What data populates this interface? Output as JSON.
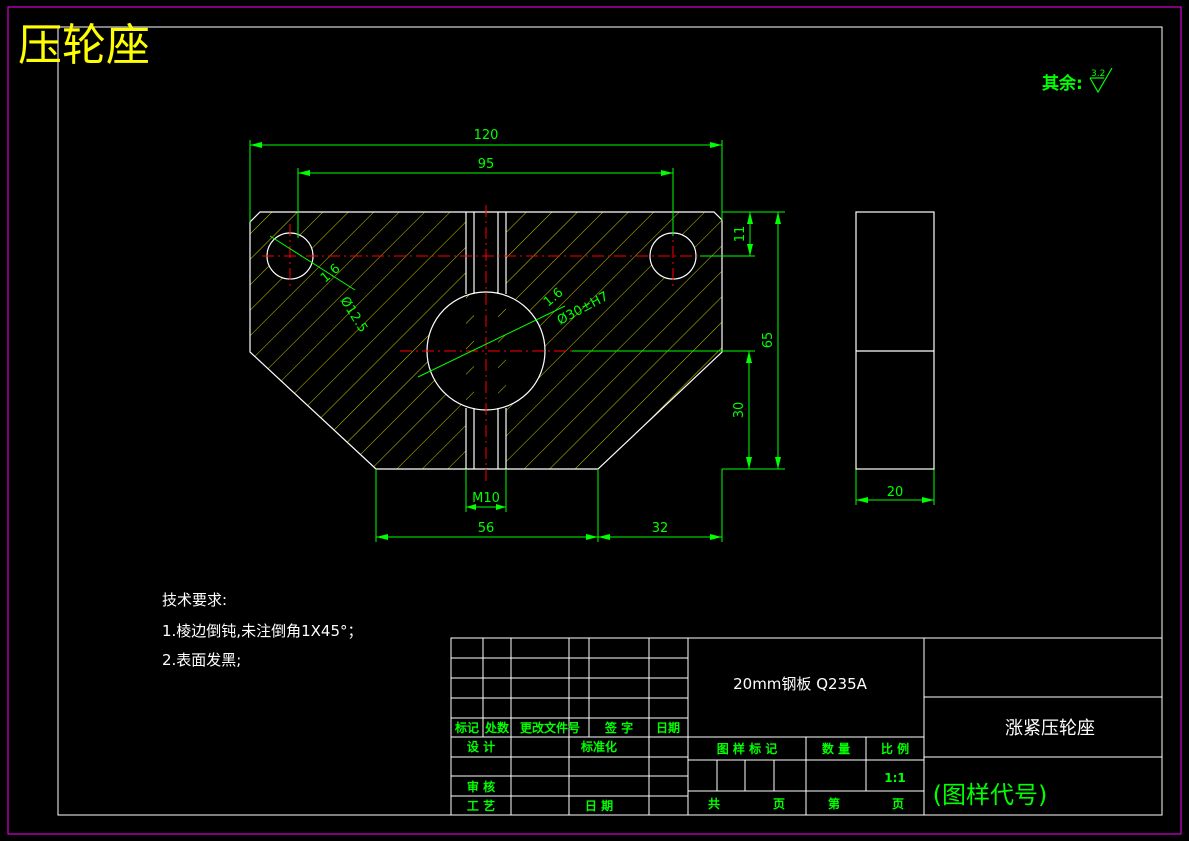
{
  "title": "压轮座",
  "surface_note": {
    "label": "其余:",
    "value": "3.2"
  },
  "dimensions": {
    "width_overall": "120",
    "hole_spacing": "95",
    "hole_offset": "11",
    "height_overall": "65",
    "center_height": "30",
    "bottom_flat": "56",
    "chamfer_width": "32",
    "slot": "M10",
    "small_hole": "Ø12.5",
    "small_chamfer": "1.6",
    "bore": "Ø30±H7",
    "bore_chamfer": "1.6",
    "thickness": "20"
  },
  "tech_requirements": {
    "heading": "技术要求:",
    "line1": "1.棱边倒钝,未注倒角1X45°；",
    "line2": "2.表面发黑;"
  },
  "title_block": {
    "material": "20mm钢板 Q235A",
    "part_name": "涨紧压轮座",
    "drawing_code": "(图样代号)",
    "biaoji": "标记",
    "chushu": "处数",
    "genggai": "更改文件号",
    "qianzi": "签 字",
    "riqi": "日期",
    "sheji": "设 计",
    "biaozhunhua": "标准化",
    "tuyang": "图 样 标 记",
    "zhongliang": "数 量",
    "bili": "比 例",
    "scale": "1:1",
    "shenhe": "审 核",
    "gongyi": "工 艺",
    "riqi2": "日 期",
    "gong": "共",
    "ye1": "页",
    "di": "第",
    "ye2": "页"
  }
}
